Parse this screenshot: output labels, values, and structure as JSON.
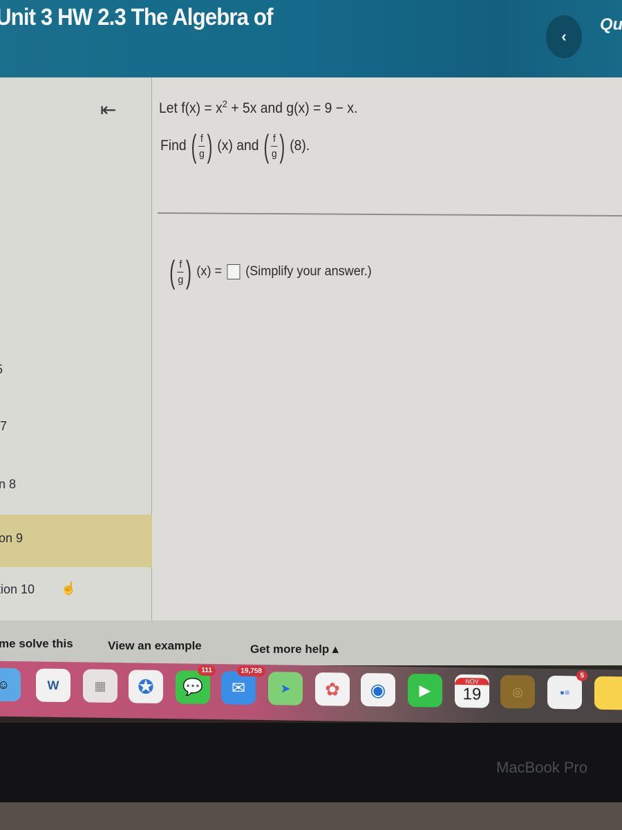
{
  "header": {
    "title": "Unit 3 HW 2.3 The Algebra of",
    "prev_icon": "chevron-left-icon",
    "right_text": "Qu"
  },
  "sidebar": {
    "collapse_icon": "collapse-left-icon",
    "items": [
      {
        "label": "5",
        "active": false
      },
      {
        "label": "7",
        "active": false
      },
      {
        "label": "n 8",
        "active": false
      },
      {
        "label": "on 9",
        "active": true
      },
      {
        "label": "tion 10",
        "active": false
      }
    ]
  },
  "question": {
    "line1_prefix": "Let f(x) = x",
    "line1_exp": "2",
    "line1_suffix": " + 5x and g(x) = 9 − x.",
    "find_label": "Find",
    "frac_num": "f",
    "frac_den": "g",
    "part1_arg": "(x) and",
    "part2_arg": "(8).",
    "answer_lhs": "(x) =",
    "answer_value": "",
    "answer_hint": "(Simplify your answer.)"
  },
  "actions": {
    "help_solve": "me solve this",
    "view_example": "View an example",
    "more_help": "Get more help ▴"
  },
  "dock": {
    "apps": [
      {
        "name": "finder",
        "badge": ""
      },
      {
        "name": "word",
        "badge": ""
      },
      {
        "name": "launchpad",
        "badge": ""
      },
      {
        "name": "safari",
        "badge": ""
      },
      {
        "name": "messages",
        "badge": "111"
      },
      {
        "name": "mail",
        "badge": "19,758"
      },
      {
        "name": "maps",
        "badge": ""
      },
      {
        "name": "photos",
        "badge": ""
      },
      {
        "name": "chrome",
        "badge": ""
      },
      {
        "name": "facetime",
        "badge": ""
      },
      {
        "name": "calendar",
        "badge": ""
      },
      {
        "name": "contacts",
        "badge": ""
      },
      {
        "name": "reminders",
        "badge": "5"
      },
      {
        "name": "notes",
        "badge": ""
      }
    ],
    "calendar_month": "NOV",
    "calendar_day": "19"
  },
  "device": {
    "label": "MacBook Pro"
  }
}
